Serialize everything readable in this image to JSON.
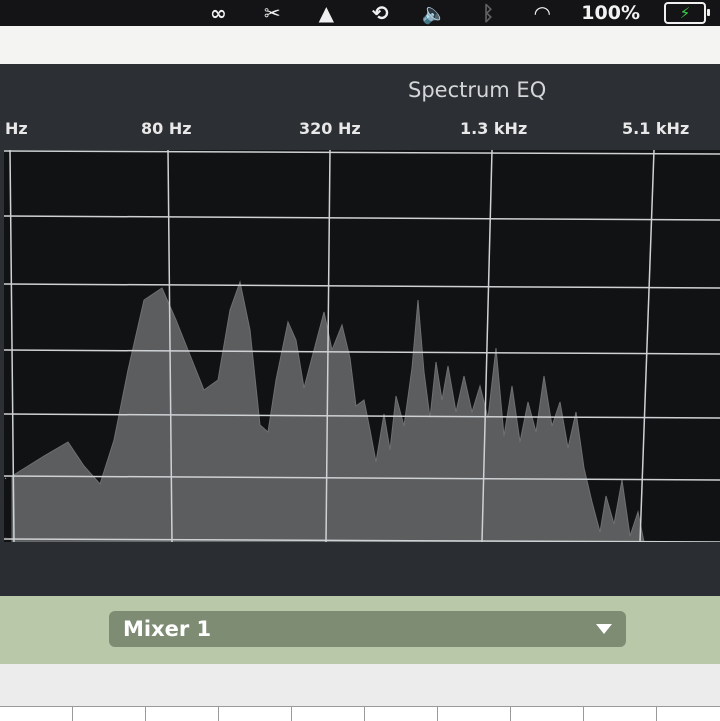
{
  "menubar": {
    "icons": [
      "creative-cloud-icon",
      "scissors-icon",
      "airplay-icon",
      "time-machine-icon",
      "volume-icon",
      "bluetooth-icon",
      "wifi-icon"
    ],
    "battery_percent": "100%"
  },
  "plugin": {
    "title": "Spectrum EQ",
    "freq_labels": [
      "Hz",
      "80 Hz",
      "320 Hz",
      "1.3 kHz",
      "5.1 kHz"
    ]
  },
  "selector": {
    "value": "Mixer 1"
  },
  "colors": {
    "panel_bg": "#2c2f33",
    "graph_bg": "#111214",
    "spectrum_fill": "#5b5d5f",
    "grid": "#cfd2d4",
    "selector_area": "#b9c8a9",
    "selector_fill": "#7d8c73"
  }
}
